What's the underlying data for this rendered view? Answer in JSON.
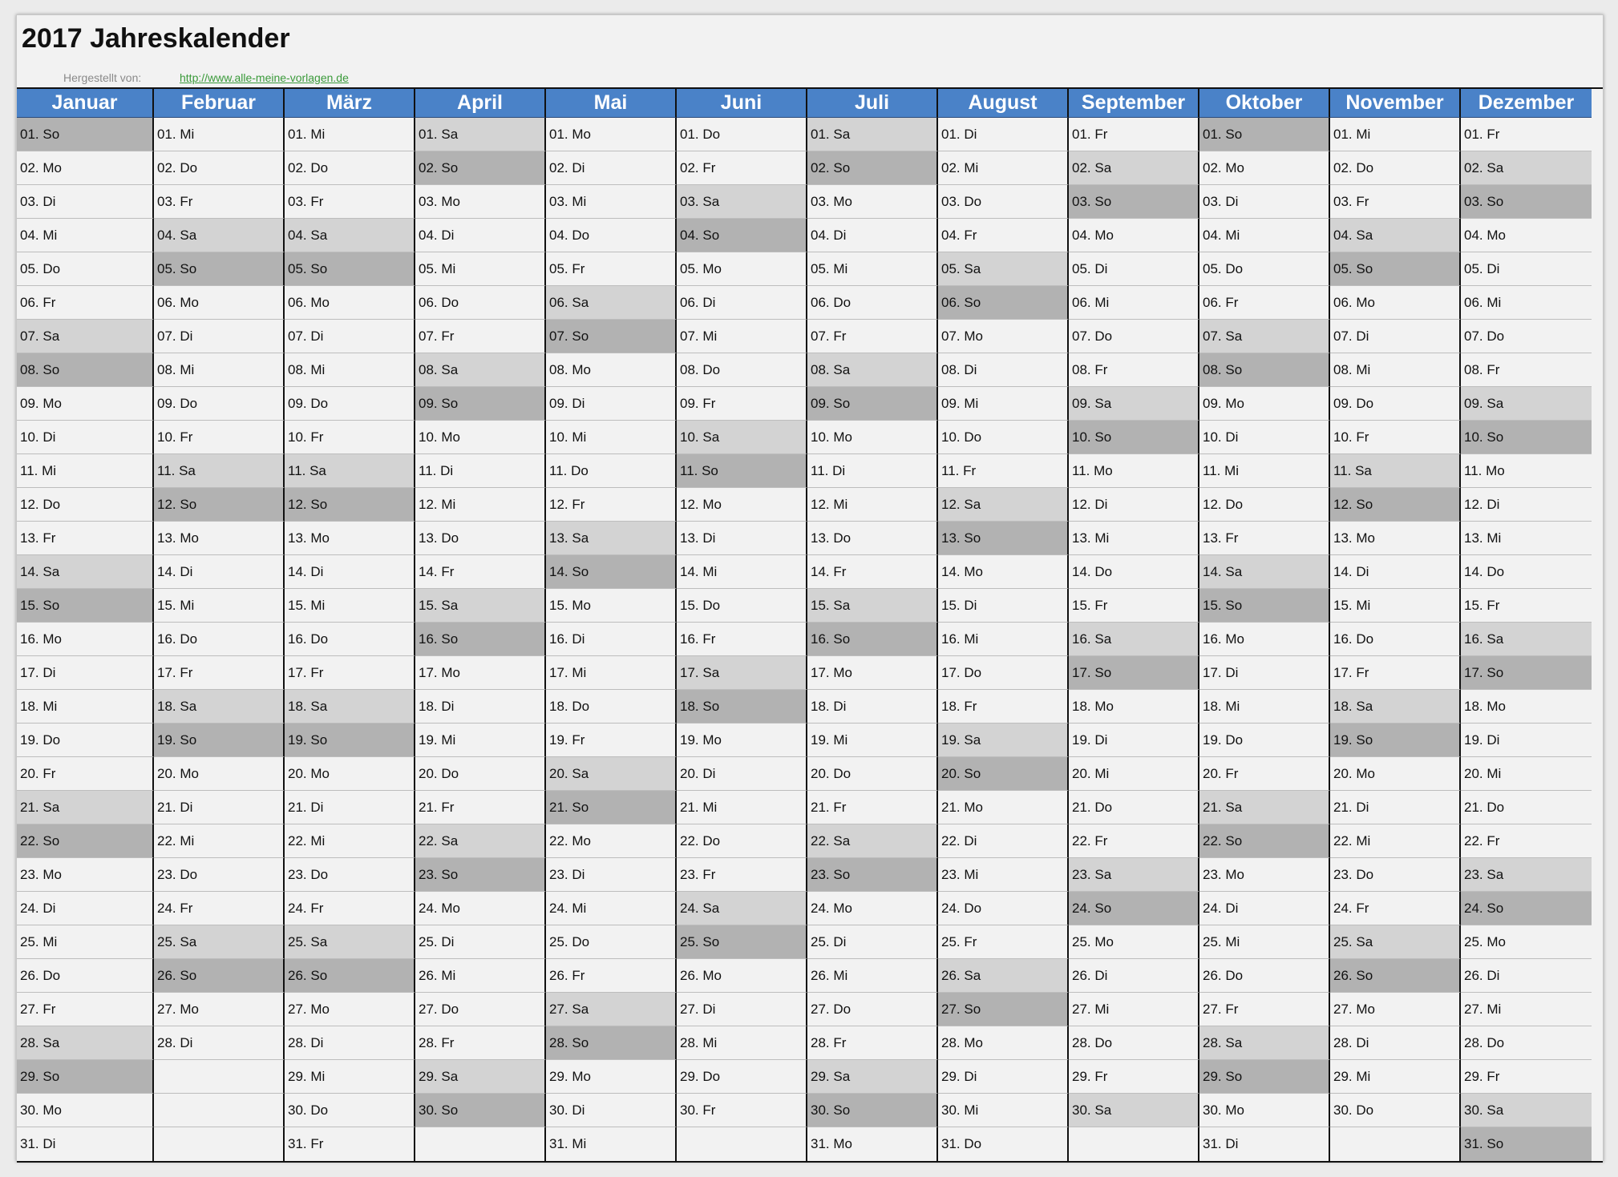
{
  "title": "2017 Jahreskalender",
  "credit_label": "Hergestellt von:",
  "credit_link": "http://www.alle-meine-vorlagen.de",
  "year": 2017,
  "colors": {
    "header_bg": "#4a82c8",
    "saturday_bg": "#d3d3d3",
    "sunday_bg": "#b2b2b2",
    "weekday_bg": "#f2f2f2"
  },
  "months": [
    {
      "name": "Januar",
      "days": [
        "01. So",
        "02. Mo",
        "03. Di",
        "04. Mi",
        "05. Do",
        "06. Fr",
        "07. Sa",
        "08. So",
        "09. Mo",
        "10. Di",
        "11. Mi",
        "12. Do",
        "13. Fr",
        "14. Sa",
        "15. So",
        "16. Mo",
        "17. Di",
        "18. Mi",
        "19. Do",
        "20. Fr",
        "21. Sa",
        "22. So",
        "23. Mo",
        "24. Di",
        "25. Mi",
        "26. Do",
        "27. Fr",
        "28. Sa",
        "29. So",
        "30. Mo",
        "31. Di"
      ]
    },
    {
      "name": "Februar",
      "days": [
        "01. Mi",
        "02. Do",
        "03. Fr",
        "04. Sa",
        "05. So",
        "06. Mo",
        "07. Di",
        "08. Mi",
        "09. Do",
        "10. Fr",
        "11. Sa",
        "12. So",
        "13. Mo",
        "14. Di",
        "15. Mi",
        "16. Do",
        "17. Fr",
        "18. Sa",
        "19. So",
        "20. Mo",
        "21. Di",
        "22. Mi",
        "23. Do",
        "24. Fr",
        "25. Sa",
        "26. So",
        "27. Mo",
        "28. Di"
      ]
    },
    {
      "name": "März",
      "days": [
        "01. Mi",
        "02. Do",
        "03. Fr",
        "04. Sa",
        "05. So",
        "06. Mo",
        "07. Di",
        "08. Mi",
        "09. Do",
        "10. Fr",
        "11. Sa",
        "12. So",
        "13. Mo",
        "14. Di",
        "15. Mi",
        "16. Do",
        "17. Fr",
        "18. Sa",
        "19. So",
        "20. Mo",
        "21. Di",
        "22. Mi",
        "23. Do",
        "24. Fr",
        "25. Sa",
        "26. So",
        "27. Mo",
        "28. Di",
        "29. Mi",
        "30. Do",
        "31. Fr"
      ]
    },
    {
      "name": "April",
      "days": [
        "01. Sa",
        "02. So",
        "03. Mo",
        "04. Di",
        "05. Mi",
        "06. Do",
        "07. Fr",
        "08. Sa",
        "09. So",
        "10. Mo",
        "11. Di",
        "12. Mi",
        "13. Do",
        "14. Fr",
        "15. Sa",
        "16. So",
        "17. Mo",
        "18. Di",
        "19. Mi",
        "20. Do",
        "21. Fr",
        "22. Sa",
        "23. So",
        "24. Mo",
        "25. Di",
        "26. Mi",
        "27. Do",
        "28. Fr",
        "29. Sa",
        "30. So"
      ]
    },
    {
      "name": "Mai",
      "days": [
        "01. Mo",
        "02. Di",
        "03. Mi",
        "04. Do",
        "05. Fr",
        "06. Sa",
        "07. So",
        "08. Mo",
        "09. Di",
        "10. Mi",
        "11. Do",
        "12. Fr",
        "13. Sa",
        "14. So",
        "15. Mo",
        "16. Di",
        "17. Mi",
        "18. Do",
        "19. Fr",
        "20. Sa",
        "21. So",
        "22. Mo",
        "23. Di",
        "24. Mi",
        "25. Do",
        "26. Fr",
        "27. Sa",
        "28. So",
        "29. Mo",
        "30. Di",
        "31. Mi"
      ]
    },
    {
      "name": "Juni",
      "days": [
        "01. Do",
        "02. Fr",
        "03. Sa",
        "04. So",
        "05. Mo",
        "06. Di",
        "07. Mi",
        "08. Do",
        "09. Fr",
        "10. Sa",
        "11. So",
        "12. Mo",
        "13. Di",
        "14. Mi",
        "15. Do",
        "16. Fr",
        "17. Sa",
        "18. So",
        "19. Mo",
        "20. Di",
        "21. Mi",
        "22. Do",
        "23. Fr",
        "24. Sa",
        "25. So",
        "26. Mo",
        "27. Di",
        "28. Mi",
        "29. Do",
        "30. Fr"
      ]
    },
    {
      "name": "Juli",
      "days": [
        "01. Sa",
        "02. So",
        "03. Mo",
        "04. Di",
        "05. Mi",
        "06. Do",
        "07. Fr",
        "08. Sa",
        "09. So",
        "10. Mo",
        "11. Di",
        "12. Mi",
        "13. Do",
        "14. Fr",
        "15. Sa",
        "16. So",
        "17. Mo",
        "18. Di",
        "19. Mi",
        "20. Do",
        "21. Fr",
        "22. Sa",
        "23. So",
        "24. Mo",
        "25. Di",
        "26. Mi",
        "27. Do",
        "28. Fr",
        "29. Sa",
        "30. So",
        "31. Mo"
      ]
    },
    {
      "name": "August",
      "days": [
        "01. Di",
        "02. Mi",
        "03. Do",
        "04. Fr",
        "05. Sa",
        "06. So",
        "07. Mo",
        "08. Di",
        "09. Mi",
        "10. Do",
        "11. Fr",
        "12. Sa",
        "13. So",
        "14. Mo",
        "15. Di",
        "16. Mi",
        "17. Do",
        "18. Fr",
        "19. Sa",
        "20. So",
        "21. Mo",
        "22. Di",
        "23. Mi",
        "24. Do",
        "25. Fr",
        "26. Sa",
        "27. So",
        "28. Mo",
        "29. Di",
        "30. Mi",
        "31. Do"
      ]
    },
    {
      "name": "September",
      "days": [
        "01. Fr",
        "02. Sa",
        "03. So",
        "04. Mo",
        "05. Di",
        "06. Mi",
        "07. Do",
        "08. Fr",
        "09. Sa",
        "10. So",
        "11. Mo",
        "12. Di",
        "13. Mi",
        "14. Do",
        "15. Fr",
        "16. Sa",
        "17. So",
        "18. Mo",
        "19. Di",
        "20. Mi",
        "21. Do",
        "22. Fr",
        "23. Sa",
        "24. So",
        "25. Mo",
        "26. Di",
        "27. Mi",
        "28. Do",
        "29. Fr",
        "30. Sa"
      ]
    },
    {
      "name": "Oktober",
      "days": [
        "01. So",
        "02. Mo",
        "03. Di",
        "04. Mi",
        "05. Do",
        "06. Fr",
        "07. Sa",
        "08. So",
        "09. Mo",
        "10. Di",
        "11. Mi",
        "12. Do",
        "13. Fr",
        "14. Sa",
        "15. So",
        "16. Mo",
        "17. Di",
        "18. Mi",
        "19. Do",
        "20. Fr",
        "21. Sa",
        "22. So",
        "23. Mo",
        "24. Di",
        "25. Mi",
        "26. Do",
        "27. Fr",
        "28. Sa",
        "29. So",
        "30. Mo",
        "31. Di"
      ]
    },
    {
      "name": "November",
      "days": [
        "01. Mi",
        "02. Do",
        "03. Fr",
        "04. Sa",
        "05. So",
        "06. Mo",
        "07. Di",
        "08. Mi",
        "09. Do",
        "10. Fr",
        "11. Sa",
        "12. So",
        "13. Mo",
        "14. Di",
        "15. Mi",
        "16. Do",
        "17. Fr",
        "18. Sa",
        "19. So",
        "20. Mo",
        "21. Di",
        "22. Mi",
        "23. Do",
        "24. Fr",
        "25. Sa",
        "26. So",
        "27. Mo",
        "28. Di",
        "29. Mi",
        "30. Do"
      ]
    },
    {
      "name": "Dezember",
      "days": [
        "01. Fr",
        "02. Sa",
        "03. So",
        "04. Mo",
        "05. Di",
        "06. Mi",
        "07. Do",
        "08. Fr",
        "09. Sa",
        "10. So",
        "11. Mo",
        "12. Di",
        "13. Mi",
        "14. Do",
        "15. Fr",
        "16. Sa",
        "17. So",
        "18. Mo",
        "19. Di",
        "20. Mi",
        "21. Do",
        "22. Fr",
        "23. Sa",
        "24. So",
        "25. Mo",
        "26. Di",
        "27. Mi",
        "28. Do",
        "29. Fr",
        "30. Sa",
        "31. So"
      ]
    }
  ]
}
